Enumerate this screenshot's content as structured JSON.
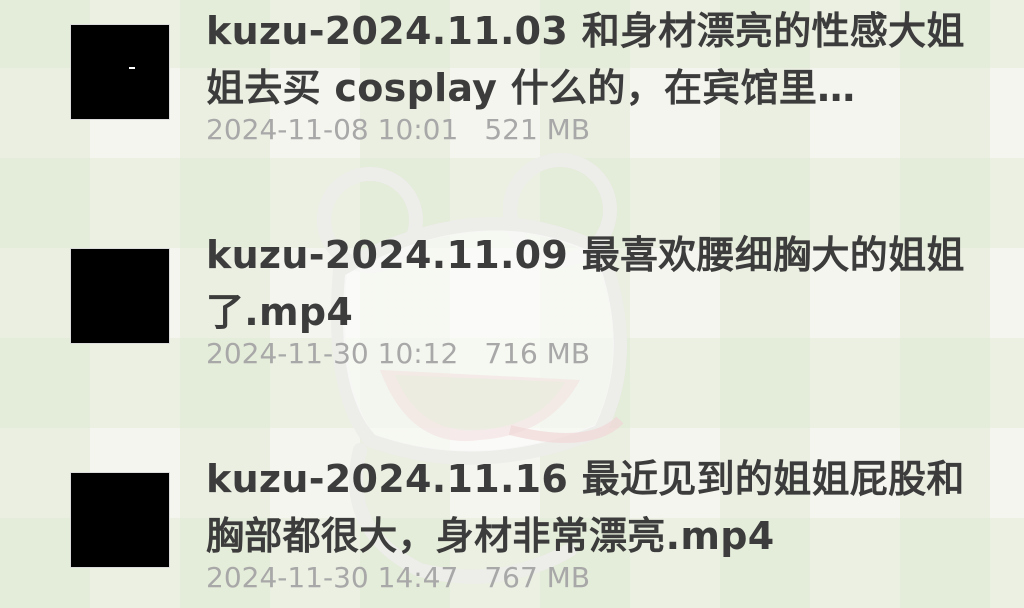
{
  "colors": {
    "title": "#3c3c3c",
    "meta": "#a8a8a8",
    "background": "#f4f5ef"
  },
  "files": [
    {
      "title": "kuzu-2024.11.03 和身材漂亮的性感大姐姐去买 cosplay 什么的，在宾馆里…",
      "date": "2024-11-08 10:01",
      "size": "521 MB"
    },
    {
      "title": "kuzu-2024.11.09 最喜欢腰细胸大的姐姐了.mp4",
      "date": "2024-11-30 10:12",
      "size": "716 MB"
    },
    {
      "title": "kuzu-2024.11.16 最近见到的姐姐屁股和胸部都很大，身材非常漂亮.mp4",
      "date": "2024-11-30 14:47",
      "size": "767 MB"
    }
  ]
}
